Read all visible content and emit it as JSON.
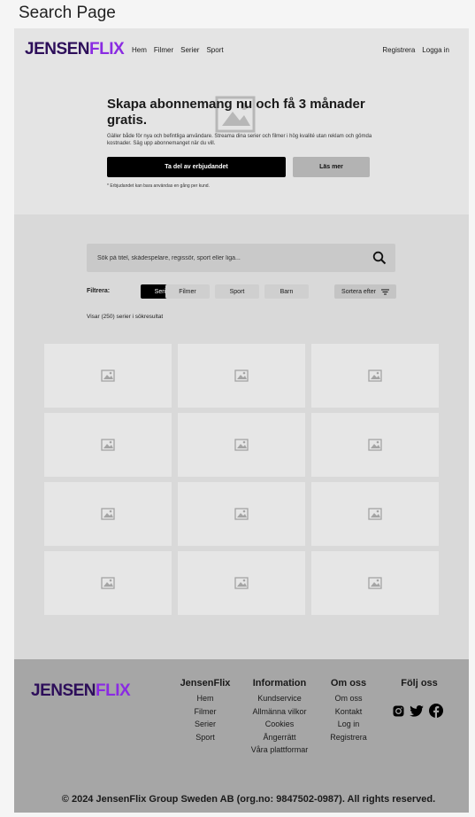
{
  "page_label": "Search Page",
  "brand": {
    "part1": "JENSEN",
    "part2": "FLIX",
    "color1": "#2d0e5a",
    "color2": "#8a2be2"
  },
  "nav": [
    "Hem",
    "Filmer",
    "Serier",
    "Sport"
  ],
  "auth": {
    "register": "Registrera",
    "login": "Logga in"
  },
  "hero": {
    "title": "Skapa abonnemang nu och få 3 månader gratis.",
    "subtitle": "Gäller både för nya och befintliga användare. Streama dina serier och filmer i hög kvalité utan reklam och gömda kostnader. Säg upp abonnemanget när du vill.",
    "primary_button": "Ta del av erbjudandet",
    "secondary_button": "Läs mer",
    "fine_print": "* Erbjudandet kan bara användas en gång per kund."
  },
  "search": {
    "placeholder": "Sök på titel, skådespelare, regissör, sport eller liga...",
    "icon": "search-icon"
  },
  "filters": {
    "label": "Filtrera:",
    "chips": [
      "Serier",
      "Filmer",
      "Sport",
      "Barn"
    ],
    "active": "Serier",
    "sort_label": "Sortera efter"
  },
  "results_text": "Visar (250) serier i sökresultat",
  "results": {
    "card_count": 12,
    "card_icon": "image-placeholder-icon"
  },
  "footer": {
    "columns": [
      {
        "title": "JensenFlix",
        "links": [
          "Hem",
          "Filmer",
          "Serier",
          "Sport"
        ]
      },
      {
        "title": "Information",
        "links": [
          "Kundservice",
          "Allmänna vilkor",
          "Cookies",
          "Ångerrätt",
          "Våra plattformar"
        ]
      },
      {
        "title": "Om oss",
        "links": [
          "Om oss",
          "Kontakt",
          "Log in",
          "Registrera"
        ]
      }
    ],
    "follow_title": "Följ oss",
    "social": [
      "instagram-icon",
      "twitter-icon",
      "facebook-icon"
    ],
    "copyright": "© 2024 JensenFlix Group Sweden AB (org.no: 9847502-0987). All rights reserved."
  }
}
